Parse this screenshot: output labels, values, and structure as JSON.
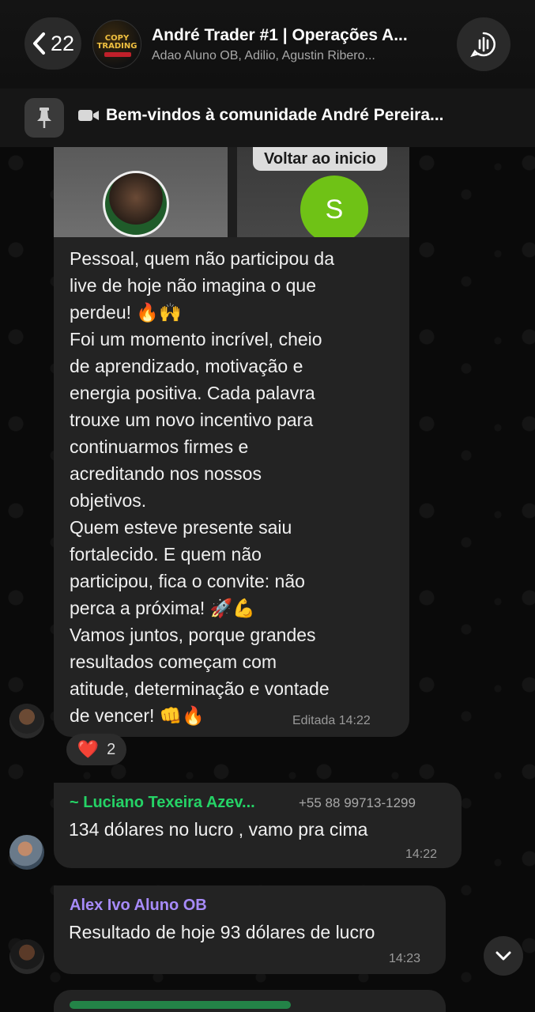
{
  "header": {
    "back_count": "22",
    "title": "André Trader #1 | Operações A...",
    "subtitle": "Adao Aluno OB, Adilio, Agustin Ribero...",
    "avatar_logo_text": "COPY TRADING"
  },
  "pinned": {
    "text": "Bem-vindos à comunidade André Pereira..."
  },
  "media": {
    "button_label": "Voltar ao inicio",
    "participant_initial": "S"
  },
  "messages": [
    {
      "text": "Pessoal, quem não participou da\nlive de hoje não imagina o que\nperdeu! 🔥🙌\nFoi um momento incrível, cheio\nde aprendizado, motivação e\nenergia positiva. Cada palavra\ntrouxe um novo incentivo para\ncontinuarmos firmes e\nacreditando nos nossos\nobjetivos.\nQuem esteve presente saiu\nfortalecido. E quem não\nparticipou, fica o convite: não\nperca a próxima! 🚀💪\nVamos juntos, porque grandes\nresultados começam com\natitude, determinação e vontade\nde vencer! 👊🔥",
      "meta": "Editada 14:22",
      "reaction_emoji": "❤️",
      "reaction_count": "2"
    },
    {
      "sender": "~ Luciano Texeira Azev...",
      "sender_color": "#25d366",
      "phone": "+55 88 99713-1299",
      "text": "134 dólares no lucro , vamo pra cima",
      "time": "14:22"
    },
    {
      "sender": "Alex Ivo Aluno OB",
      "sender_color": "#a78bfa",
      "text": "Resultado de hoje 93 dólares de lucro",
      "time": "14:23"
    },
    {
      "sender_color": "#25d366"
    }
  ],
  "colors": {
    "background": "#0b0b0b",
    "bubble": "#232323",
    "accent_green": "#25d366"
  },
  "icons": {
    "back": "chevron-left-icon",
    "call": "voice-chat-icon",
    "pin": "pin-icon",
    "video": "video-camera-icon",
    "scroll": "chevron-down-icon"
  }
}
